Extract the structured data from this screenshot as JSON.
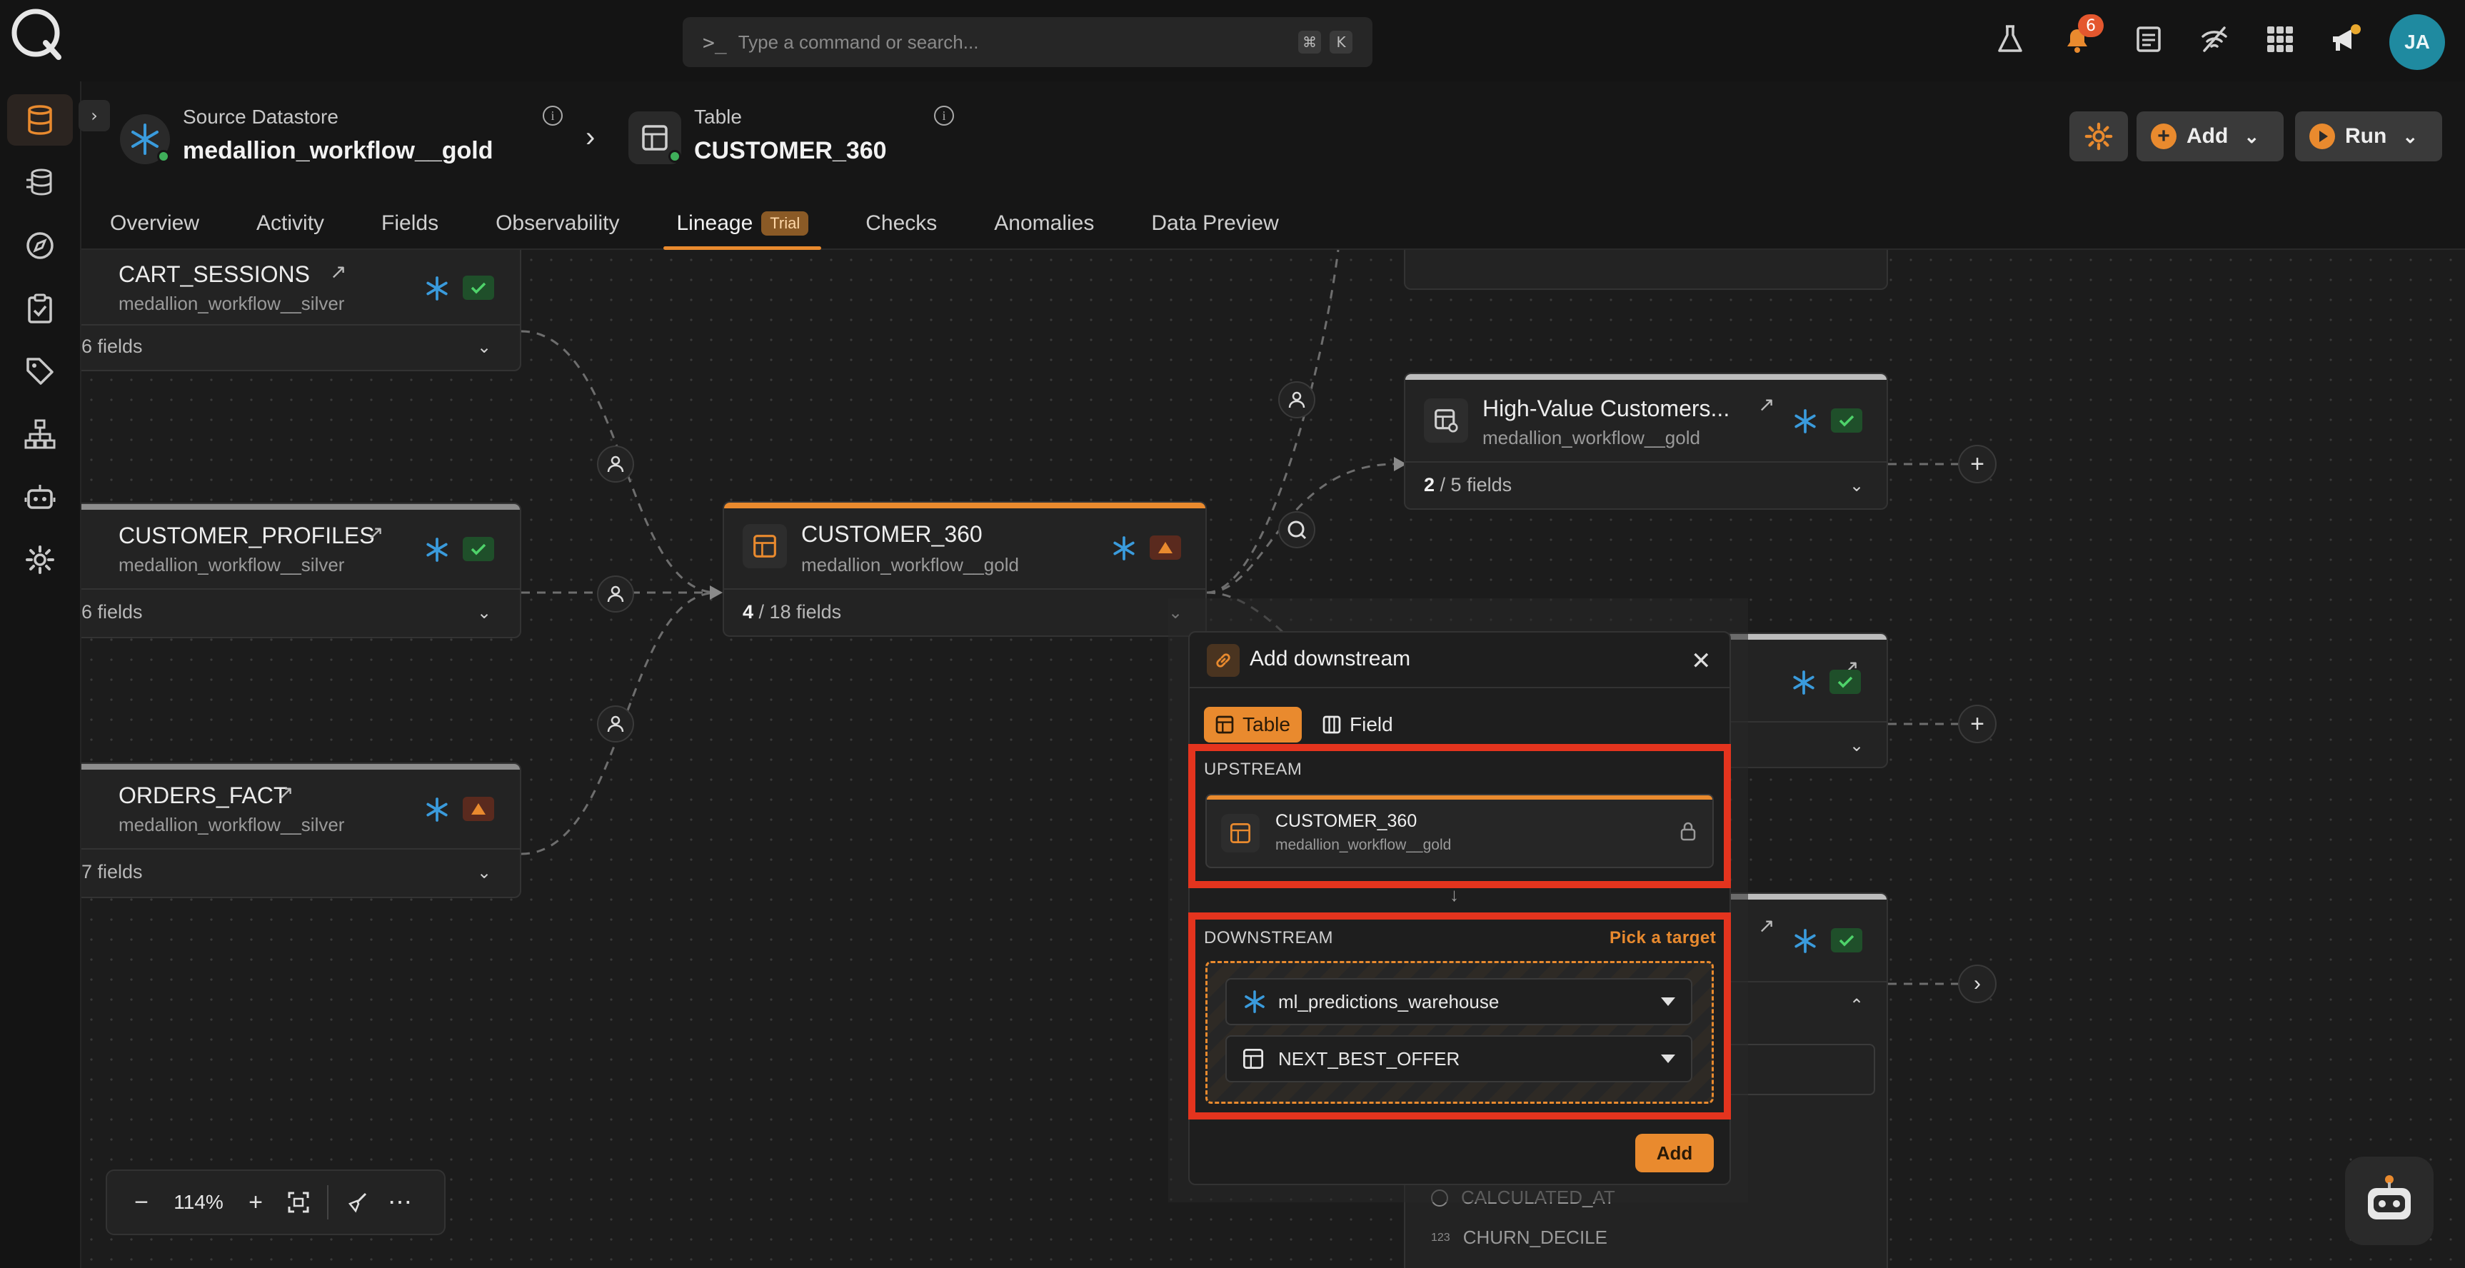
{
  "search": {
    "placeholder": "Type a command or search...",
    "prompt": ">_",
    "kbd1": "⌘",
    "kbd2": "K"
  },
  "notifications": {
    "count": "6"
  },
  "user": {
    "initials": "JA"
  },
  "breadcrumb": {
    "source_label": "Source Datastore",
    "source_name": "medallion_workflow__gold",
    "table_label": "Table",
    "table_name": "CUSTOMER_360"
  },
  "actions": {
    "add_label": "Add",
    "run_label": "Run"
  },
  "tabs": [
    {
      "label": "Overview"
    },
    {
      "label": "Activity"
    },
    {
      "label": "Fields"
    },
    {
      "label": "Observability"
    },
    {
      "label": "Lineage",
      "badge": "Trial"
    },
    {
      "label": "Checks"
    },
    {
      "label": "Anomalies"
    },
    {
      "label": "Data Preview"
    }
  ],
  "nodes": {
    "cart_sessions": {
      "title": "CART_SESSIONS",
      "sub": "medallion_workflow__silver",
      "fields": "6 fields"
    },
    "customer_profiles": {
      "title": "CUSTOMER_PROFILES",
      "sub": "medallion_workflow__silver",
      "fields": "6 fields"
    },
    "orders_fact": {
      "title": "ORDERS_FACT",
      "sub": "medallion_workflow__silver",
      "fields": "7 fields"
    },
    "customer_360": {
      "title": "CUSTOMER_360",
      "sub": "medallion_workflow__gold",
      "fields_count": "4",
      "fields_total": "/ 18 fields"
    },
    "high_value": {
      "title": "High-Value Customers...",
      "sub": "medallion_workflow__gold",
      "fields_count": "2",
      "fields_total": "/ 5 fields"
    },
    "field_rows": [
      "CALCULATED_AT",
      "CHURN_DECILE"
    ],
    "field_row_type": "123"
  },
  "modal": {
    "title": "Add downstream",
    "seg_table": "Table",
    "seg_field": "Field",
    "upstream_label": "UPSTREAM",
    "upstream_title": "CUSTOMER_360",
    "upstream_sub": "medallion_workflow__gold",
    "downstream_label": "DOWNSTREAM",
    "pick_target": "Pick a target",
    "datastore_value": "ml_predictions_warehouse",
    "table_value": "NEXT_BEST_OFFER",
    "add_label": "Add"
  },
  "zoom": {
    "level": "114%"
  },
  "colors": {
    "accent": "#e98a2e",
    "highlight": "#e4341e",
    "ok": "#3fae5a",
    "snowflake": "#3a9bdc"
  }
}
